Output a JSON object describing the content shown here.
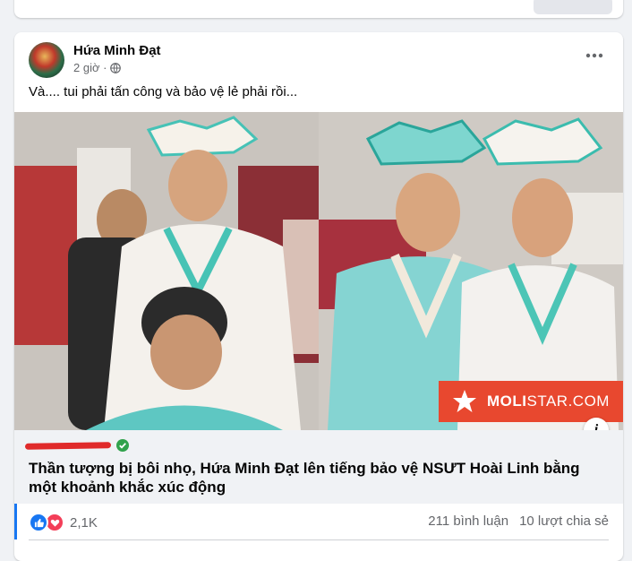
{
  "post": {
    "author": "Hứa Minh Đạt",
    "time": "2 giờ ·",
    "privacy_icon": "globe-icon",
    "caption": "Và.... tui phải tấn công và bảo vệ lẻ phải rồi...",
    "more_icon": "more-horizontal-icon"
  },
  "image": {
    "watermark_brand": "MOLISTAR.COM",
    "watermark_strong": "MOLI",
    "watermark_rest": "STAR.COM",
    "info_label": "i"
  },
  "link_preview": {
    "headline": "Thần tượng bị bôi nhọ, Hứa Minh Đạt lên tiếng bảo vệ NSƯT Hoài Linh bằng một khoảnh khắc xúc động"
  },
  "engagement": {
    "reactions": [
      "like",
      "love"
    ],
    "reaction_count": "2,1K",
    "comments": "211 bình luận",
    "shares": "10 lượt chia sẻ"
  },
  "colors": {
    "accent": "#1877f2",
    "love": "#f33e58",
    "brand": "#e8482f",
    "verified": "#31a24c"
  }
}
